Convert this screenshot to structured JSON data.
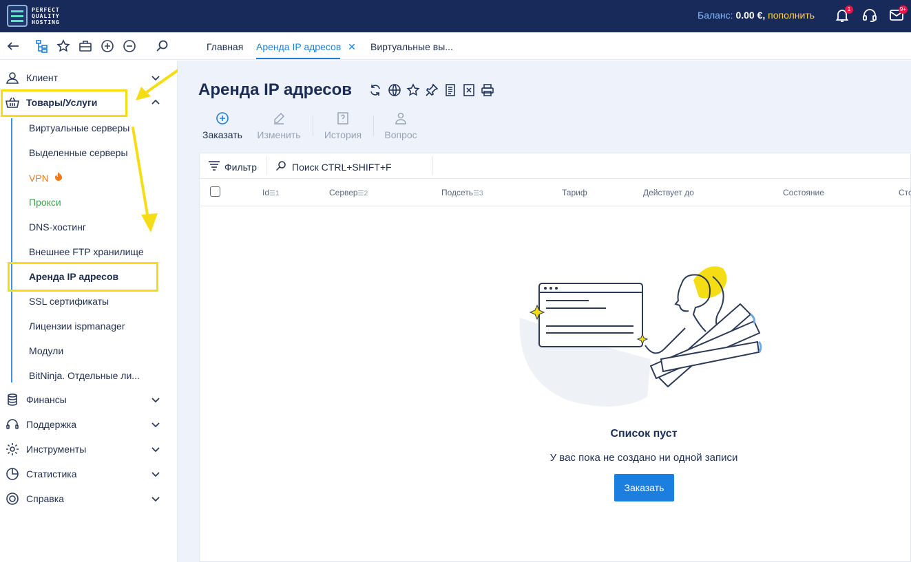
{
  "header": {
    "logo_lines": [
      "PERFECT",
      "QUALITY",
      "HOSTING"
    ],
    "balance_label": "Баланс:",
    "balance_amount": "0.00 €,",
    "topup_label": "пополнить",
    "notifications_badge": "1",
    "messages_badge": "9+"
  },
  "tabs": [
    {
      "label": "Главная"
    },
    {
      "label": "Аренда IP адресов"
    },
    {
      "label": "Виртуальные вы..."
    }
  ],
  "sidebar": {
    "items": [
      {
        "label": "Клиент",
        "icon": "user-icon"
      },
      {
        "label": "Товары/Услуги",
        "icon": "basket-icon"
      },
      {
        "label": "Финансы",
        "icon": "coins-icon"
      },
      {
        "label": "Поддержка",
        "icon": "headset-icon"
      },
      {
        "label": "Инструменты",
        "icon": "gear-icon"
      },
      {
        "label": "Статистика",
        "icon": "pie-chart-icon"
      },
      {
        "label": "Справка",
        "icon": "lifebuoy-icon"
      }
    ],
    "subitems": [
      {
        "label": "Виртуальные серверы"
      },
      {
        "label": "Выделенные серверы"
      },
      {
        "label": "VPN"
      },
      {
        "label": "Прокси"
      },
      {
        "label": "DNS-хостинг"
      },
      {
        "label": "Внешнее FTP хранилище"
      },
      {
        "label": "Аренда IP адресов"
      },
      {
        "label": "SSL сертификаты"
      },
      {
        "label": "Лицензии ispmanager"
      },
      {
        "label": "Модули"
      },
      {
        "label": "BitNinja. Отдельные ли..."
      }
    ]
  },
  "page": {
    "title": "Аренда IP адресов",
    "actions": [
      {
        "label": "Заказать",
        "enabled": true
      },
      {
        "label": "Изменить",
        "enabled": false
      },
      {
        "label": "История",
        "enabled": false
      },
      {
        "label": "Вопрос",
        "enabled": false
      }
    ],
    "filter_label": "Фильтр",
    "search_placeholder": "Поиск CTRL+SHIFT+F",
    "columns": [
      {
        "label": "Id",
        "sort": "1"
      },
      {
        "label": "Сервер",
        "sort": "2"
      },
      {
        "label": "Подсеть",
        "sort": "3"
      },
      {
        "label": "Тариф"
      },
      {
        "label": "Действует до"
      },
      {
        "label": "Состояние"
      },
      {
        "label": "Сто"
      }
    ],
    "empty_title": "Список пуст",
    "empty_subtitle": "У вас пока не создано ни одной записи",
    "order_button": "Заказать"
  },
  "colors": {
    "header_bg": "#182a5a",
    "accent": "#1c7fe0",
    "highlight": "#f5dd16",
    "vpn": "#e87a1c",
    "proxy": "#3aa54a"
  }
}
